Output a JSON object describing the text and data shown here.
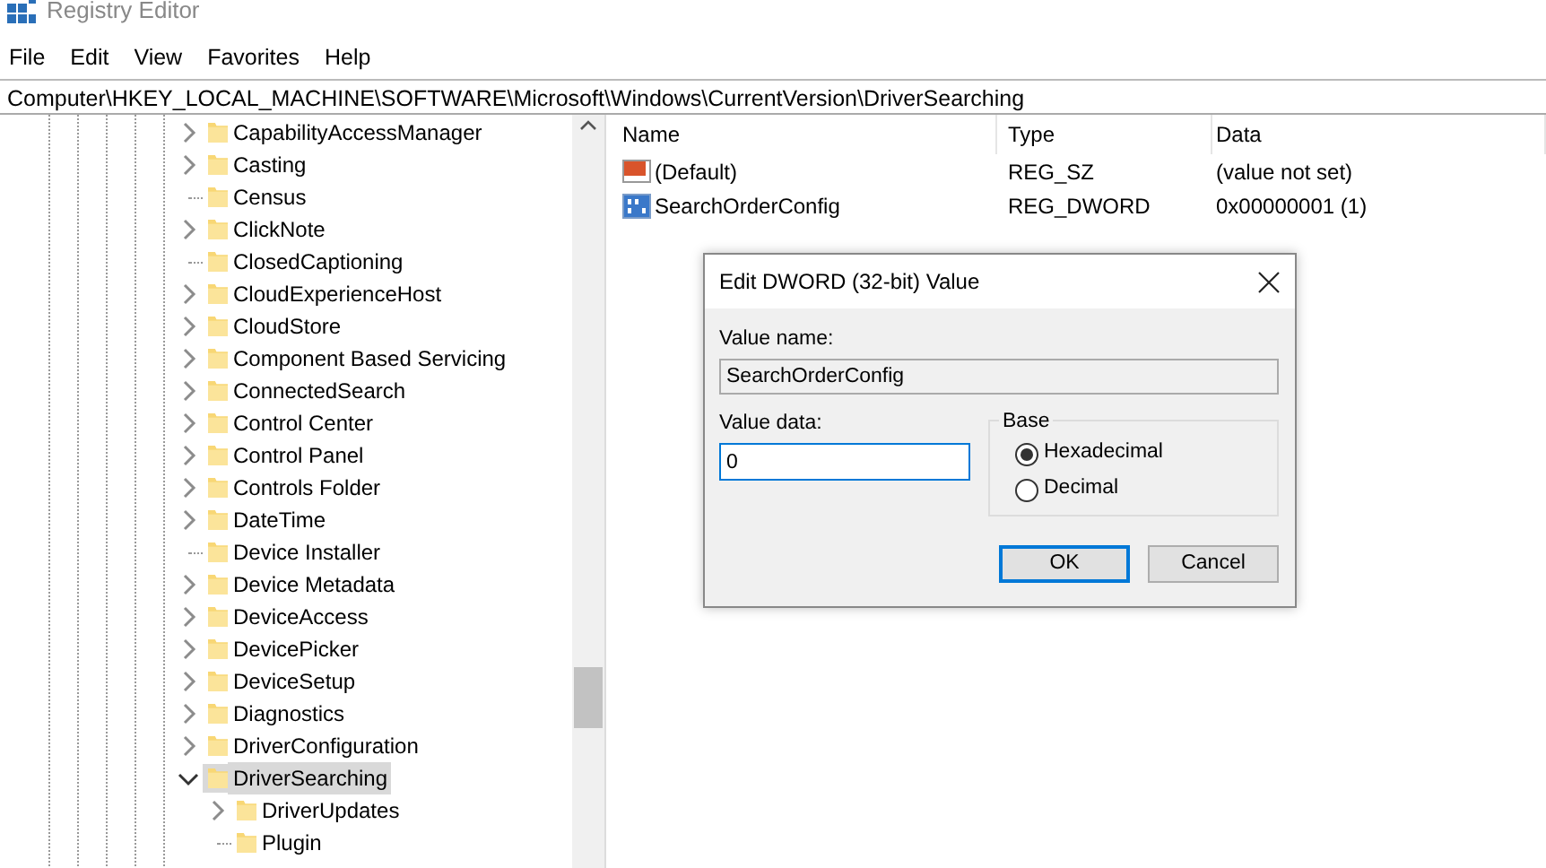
{
  "window": {
    "title": "Registry Editor"
  },
  "menu": [
    "File",
    "Edit",
    "View",
    "Favorites",
    "Help"
  ],
  "address": "Computer\\HKEY_LOCAL_MACHINE\\SOFTWARE\\Microsoft\\Windows\\CurrentVersion\\DriverSearching",
  "tree": [
    {
      "label": "CapabilityAccessManager",
      "has_children": true,
      "expanded": false,
      "selected": false
    },
    {
      "label": "Casting",
      "has_children": true,
      "expanded": false,
      "selected": false
    },
    {
      "label": "Census",
      "has_children": false,
      "selected": false
    },
    {
      "label": "ClickNote",
      "has_children": true,
      "expanded": false,
      "selected": false
    },
    {
      "label": "ClosedCaptioning",
      "has_children": false,
      "selected": false
    },
    {
      "label": "CloudExperienceHost",
      "has_children": true,
      "expanded": false,
      "selected": false
    },
    {
      "label": "CloudStore",
      "has_children": true,
      "expanded": false,
      "selected": false
    },
    {
      "label": "Component Based Servicing",
      "has_children": true,
      "expanded": false,
      "selected": false
    },
    {
      "label": "ConnectedSearch",
      "has_children": true,
      "expanded": false,
      "selected": false
    },
    {
      "label": "Control Center",
      "has_children": true,
      "expanded": false,
      "selected": false
    },
    {
      "label": "Control Panel",
      "has_children": true,
      "expanded": false,
      "selected": false
    },
    {
      "label": "Controls Folder",
      "has_children": true,
      "expanded": false,
      "selected": false
    },
    {
      "label": "DateTime",
      "has_children": true,
      "expanded": false,
      "selected": false
    },
    {
      "label": "Device Installer",
      "has_children": false,
      "selected": false
    },
    {
      "label": "Device Metadata",
      "has_children": true,
      "expanded": false,
      "selected": false
    },
    {
      "label": "DeviceAccess",
      "has_children": true,
      "expanded": false,
      "selected": false
    },
    {
      "label": "DevicePicker",
      "has_children": true,
      "expanded": false,
      "selected": false
    },
    {
      "label": "DeviceSetup",
      "has_children": true,
      "expanded": false,
      "selected": false
    },
    {
      "label": "Diagnostics",
      "has_children": true,
      "expanded": false,
      "selected": false
    },
    {
      "label": "DriverConfiguration",
      "has_children": true,
      "expanded": false,
      "selected": false
    },
    {
      "label": "DriverSearching",
      "has_children": true,
      "expanded": true,
      "selected": true,
      "children": [
        {
          "label": "DriverUpdates",
          "has_children": true,
          "expanded": false,
          "selected": false
        },
        {
          "label": "Plugin",
          "has_children": false,
          "selected": false
        }
      ]
    }
  ],
  "values": {
    "columns": [
      "Name",
      "Type",
      "Data"
    ],
    "rows": [
      {
        "kind": "string",
        "name": "(Default)",
        "type": "REG_SZ",
        "data": "(value not set)"
      },
      {
        "kind": "binary",
        "name": "SearchOrderConfig",
        "type": "REG_DWORD",
        "data": "0x00000001 (1)"
      }
    ]
  },
  "dialog": {
    "title": "Edit DWORD (32-bit) Value",
    "value_name_label": "Value name:",
    "value_name": "SearchOrderConfig",
    "value_data_label": "Value data:",
    "value_data": "0",
    "base": {
      "label": "Base",
      "options": [
        {
          "label": "Hexadecimal",
          "selected": true
        },
        {
          "label": "Decimal",
          "selected": false
        }
      ]
    },
    "buttons": [
      {
        "label": "OK",
        "default": true
      },
      {
        "label": "Cancel",
        "default": false
      }
    ]
  }
}
